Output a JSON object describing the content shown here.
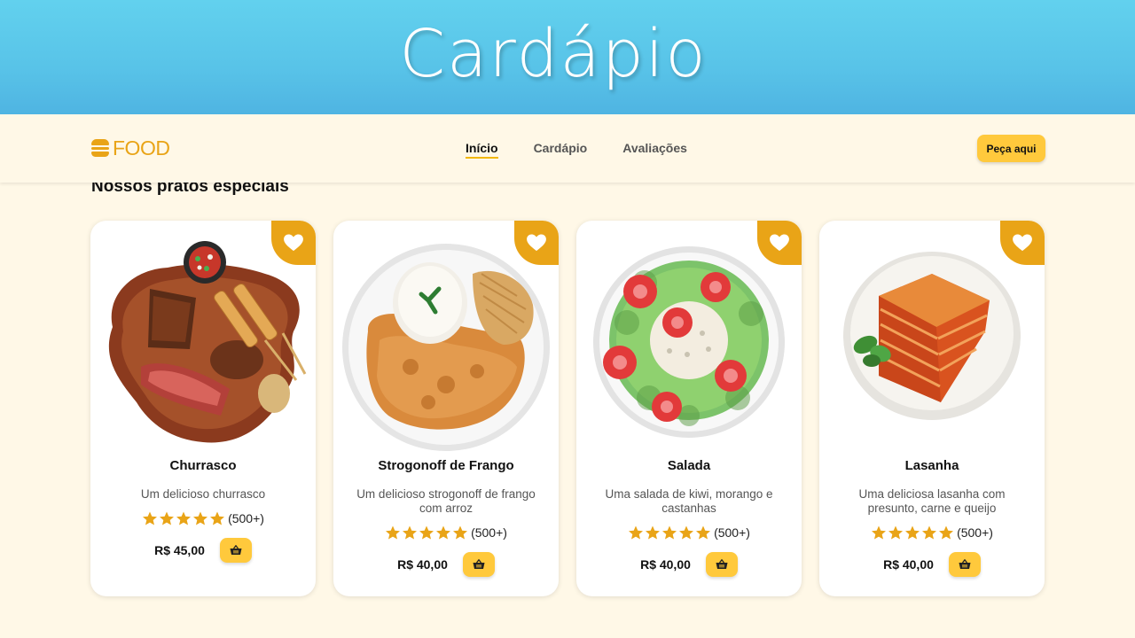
{
  "banner": {
    "title": "Cardápio"
  },
  "brand": {
    "name": "FOOD",
    "icon": "burger-icon",
    "color": "#e9a417"
  },
  "nav": {
    "links": [
      "Início",
      "Cardápio",
      "Avaliações"
    ],
    "active": "Início",
    "order_label": "Peça aqui"
  },
  "section": {
    "title": "Nossos pratos especiais"
  },
  "colors": {
    "accent": "#ffc93c",
    "favorite": "#e9a417",
    "star": "#e9a417",
    "banner": "#58c3e8",
    "background": "#fff8e7"
  },
  "dishes": [
    {
      "name": "Churrasco",
      "description": "Um delicioso churrasco",
      "rating_count": "(500+)",
      "stars": 5,
      "price": "R$ 45,00",
      "image": "barbecue-board"
    },
    {
      "name": "Strogonoff de Frango",
      "description": "Um delicioso strogonoff de frango com arroz",
      "rating_count": "(500+)",
      "stars": 5,
      "price": "R$ 40,00",
      "image": "strogonoff-plate"
    },
    {
      "name": "Salada",
      "description": "Uma salada de kiwi, morango e castanhas",
      "rating_count": "(500+)",
      "stars": 5,
      "price": "R$ 40,00",
      "image": "salad-bowl"
    },
    {
      "name": "Lasanha",
      "description": "Uma deliciosa lasanha com presunto, carne e queijo",
      "rating_count": "(500+)",
      "stars": 5,
      "price": "R$ 40,00",
      "image": "lasagna-plate"
    }
  ]
}
